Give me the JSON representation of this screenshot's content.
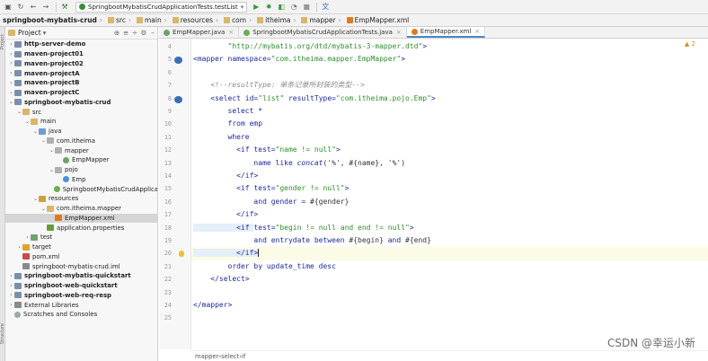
{
  "toolbar": {
    "run_config": "SpringbootMybatisCrudApplicationTests.testList",
    "icons": [
      "save-icon",
      "sync-icon",
      "back-icon",
      "forward-icon",
      "build-icon",
      "run-icon",
      "debug-icon",
      "coverage-icon",
      "profile-icon",
      "stop-icon",
      "translate-icon"
    ]
  },
  "breadcrumb": [
    "springboot-mybatis-crud",
    "src",
    "main",
    "resources",
    "com",
    "itheima",
    "mapper",
    "EmpMapper.xml"
  ],
  "project": {
    "title": "Project",
    "tree": [
      {
        "label": "http-server-demo",
        "bold": true,
        "depth": 1,
        "icon": "mod",
        "arrow": ">"
      },
      {
        "label": "maven-project01",
        "bold": true,
        "depth": 1,
        "icon": "mod",
        "arrow": ">"
      },
      {
        "label": "maven-project02",
        "bold": true,
        "depth": 1,
        "icon": "mod",
        "arrow": ">"
      },
      {
        "label": "maven-projectA",
        "bold": true,
        "depth": 1,
        "icon": "mod",
        "arrow": ">"
      },
      {
        "label": "maven-projectB",
        "bold": true,
        "depth": 1,
        "icon": "mod",
        "arrow": ">"
      },
      {
        "label": "maven-projectC",
        "bold": true,
        "depth": 1,
        "icon": "mod",
        "arrow": ">"
      },
      {
        "label": "springboot-mybatis-crud",
        "bold": true,
        "depth": 1,
        "icon": "mod",
        "arrow": "v"
      },
      {
        "label": "src",
        "bold": false,
        "depth": 2,
        "icon": "folder",
        "arrow": "v"
      },
      {
        "label": "main",
        "bold": false,
        "depth": 3,
        "icon": "folder",
        "arrow": "v"
      },
      {
        "label": "java",
        "bold": false,
        "depth": 4,
        "icon": "src",
        "arrow": "v"
      },
      {
        "label": "com.itheima",
        "bold": false,
        "depth": 5,
        "icon": "pkg",
        "arrow": "v"
      },
      {
        "label": "mapper",
        "bold": false,
        "depth": 6,
        "icon": "pkg",
        "arrow": "v"
      },
      {
        "label": "EmpMapper",
        "bold": false,
        "depth": 7,
        "icon": "iface",
        "arrow": ""
      },
      {
        "label": "pojo",
        "bold": false,
        "depth": 6,
        "icon": "pkg",
        "arrow": "v"
      },
      {
        "label": "Emp",
        "bold": false,
        "depth": 7,
        "icon": "class",
        "arrow": ""
      },
      {
        "label": "SpringbootMybatisCrudApplica",
        "bold": false,
        "depth": 6,
        "icon": "spring",
        "arrow": ""
      },
      {
        "label": "resources",
        "bold": false,
        "depth": 4,
        "icon": "res",
        "arrow": "v"
      },
      {
        "label": "com.itheima.mapper",
        "bold": false,
        "depth": 5,
        "icon": "folder",
        "arrow": "v"
      },
      {
        "label": "EmpMapper.xml",
        "bold": false,
        "depth": 6,
        "icon": "xml",
        "arrow": "",
        "selected": true
      },
      {
        "label": "application.properties",
        "bold": false,
        "depth": 5,
        "icon": "prop",
        "arrow": ""
      },
      {
        "label": "test",
        "bold": false,
        "depth": 3,
        "icon": "test",
        "arrow": ">"
      },
      {
        "label": "target",
        "bold": false,
        "depth": 2,
        "icon": "target",
        "arrow": ">"
      },
      {
        "label": "pom.xml",
        "bold": false,
        "depth": 2,
        "icon": "mvn",
        "arrow": ""
      },
      {
        "label": "springboot-mybatis-crud.iml",
        "bold": false,
        "depth": 2,
        "icon": "lib",
        "arrow": ""
      },
      {
        "label": "springboot-mybatis-quickstart",
        "bold": true,
        "depth": 1,
        "icon": "mod",
        "arrow": ">"
      },
      {
        "label": "springboot-web-quickstart",
        "bold": true,
        "depth": 1,
        "icon": "mod",
        "arrow": ">"
      },
      {
        "label": "springboot-web-req-resp",
        "bold": true,
        "depth": 1,
        "icon": "mod",
        "arrow": ">"
      },
      {
        "label": "External Libraries",
        "bold": false,
        "depth": 1,
        "icon": "lib",
        "arrow": ">"
      },
      {
        "label": "Scratches and Consoles",
        "bold": false,
        "depth": 1,
        "icon": "scr",
        "arrow": ""
      }
    ]
  },
  "tabs": [
    {
      "label": "EmpMapper.java",
      "icon_color": "#6aa36a",
      "active": false
    },
    {
      "label": "SpringbootMybatisCrudApplicationTests.java",
      "icon_color": "#6ab04c",
      "active": false
    },
    {
      "label": "EmpMapper.xml",
      "icon_color": "#e07a1e",
      "active": true
    }
  ],
  "editor": {
    "warning": "2",
    "line_numbers": [
      "4",
      "5",
      "6",
      "7",
      "8",
      "9",
      "10",
      "11",
      "12",
      "13",
      "14",
      "15",
      "16",
      "17",
      "18",
      "19",
      "20",
      "21",
      "22",
      "23",
      "24",
      "25"
    ],
    "code_breadcrumb": [
      "mapper",
      "select",
      "if"
    ],
    "lines": [
      [
        {
          "t": "        ",
          "c": ""
        },
        {
          "t": "\"http://mybatis.org/dtd/mybatis-3-mapper.dtd\"",
          "c": "sv"
        },
        {
          "t": ">",
          "c": "tg"
        }
      ],
      [
        {
          "t": "<mapper ",
          "c": "tg"
        },
        {
          "t": "namespace=",
          "c": "at"
        },
        {
          "t": "\"com.itheima.mapper.EmpMapper\"",
          "c": "sv"
        },
        {
          "t": ">",
          "c": "tg"
        }
      ],
      [
        {
          "t": "",
          "c": ""
        }
      ],
      [
        {
          "t": "    <!--resultType: 单条记录所封装的类型-->",
          "c": "cm"
        }
      ],
      [
        {
          "t": "    <select ",
          "c": "tg"
        },
        {
          "t": "id=",
          "c": "at"
        },
        {
          "t": "\"list\"",
          "c": "sv"
        },
        {
          "t": " resultType=",
          "c": "at"
        },
        {
          "t": "\"com.itheima.pojo.Emp\"",
          "c": "sv"
        },
        {
          "t": ">",
          "c": "tg"
        }
      ],
      [
        {
          "t": "        select *",
          "c": "kw"
        }
      ],
      [
        {
          "t": "        from emp",
          "c": "kw"
        }
      ],
      [
        {
          "t": "        where",
          "c": "kw"
        }
      ],
      [
        {
          "t": "          <if ",
          "c": "tg"
        },
        {
          "t": "test=",
          "c": "at"
        },
        {
          "t": "\"name != null\"",
          "c": "sv"
        },
        {
          "t": ">",
          "c": "tg"
        }
      ],
      [
        {
          "t": "              name like ",
          "c": "kw"
        },
        {
          "t": "concat",
          "c": "fn"
        },
        {
          "t": "('%', #{name}, '%')",
          "c": "tx2"
        }
      ],
      [
        {
          "t": "          </if>",
          "c": "tg"
        }
      ],
      [
        {
          "t": "          <if ",
          "c": "tg"
        },
        {
          "t": "test=",
          "c": "at"
        },
        {
          "t": "\"gender != null\"",
          "c": "sv"
        },
        {
          "t": ">",
          "c": "tg"
        }
      ],
      [
        {
          "t": "              and gender = ",
          "c": "kw"
        },
        {
          "t": "#{gender}",
          "c": "tx2"
        }
      ],
      [
        {
          "t": "          </if>",
          "c": "tg"
        }
      ],
      [
        {
          "t": "          <if ",
          "c": "tg"
        },
        {
          "t": "test=",
          "c": "at"
        },
        {
          "t": "\"begin != null and end != null\"",
          "c": "sv"
        },
        {
          "t": ">",
          "c": "tg"
        }
      ],
      [
        {
          "t": "              and entrydate between ",
          "c": "kw"
        },
        {
          "t": "#{begin}",
          "c": "tx2"
        },
        {
          "t": " and ",
          "c": "kw"
        },
        {
          "t": "#{end}",
          "c": "tx2"
        }
      ],
      [
        {
          "t": "          </if>",
          "c": "tg"
        }
      ],
      [
        {
          "t": "        order by update_time desc",
          "c": "kw"
        }
      ],
      [
        {
          "t": "    </select>",
          "c": "tg"
        }
      ],
      [
        {
          "t": "",
          "c": ""
        }
      ],
      [
        {
          "t": "</mapper>",
          "c": "tg"
        }
      ],
      [
        {
          "t": "",
          "c": ""
        }
      ]
    ]
  },
  "watermark": "CSDN @幸运小新"
}
